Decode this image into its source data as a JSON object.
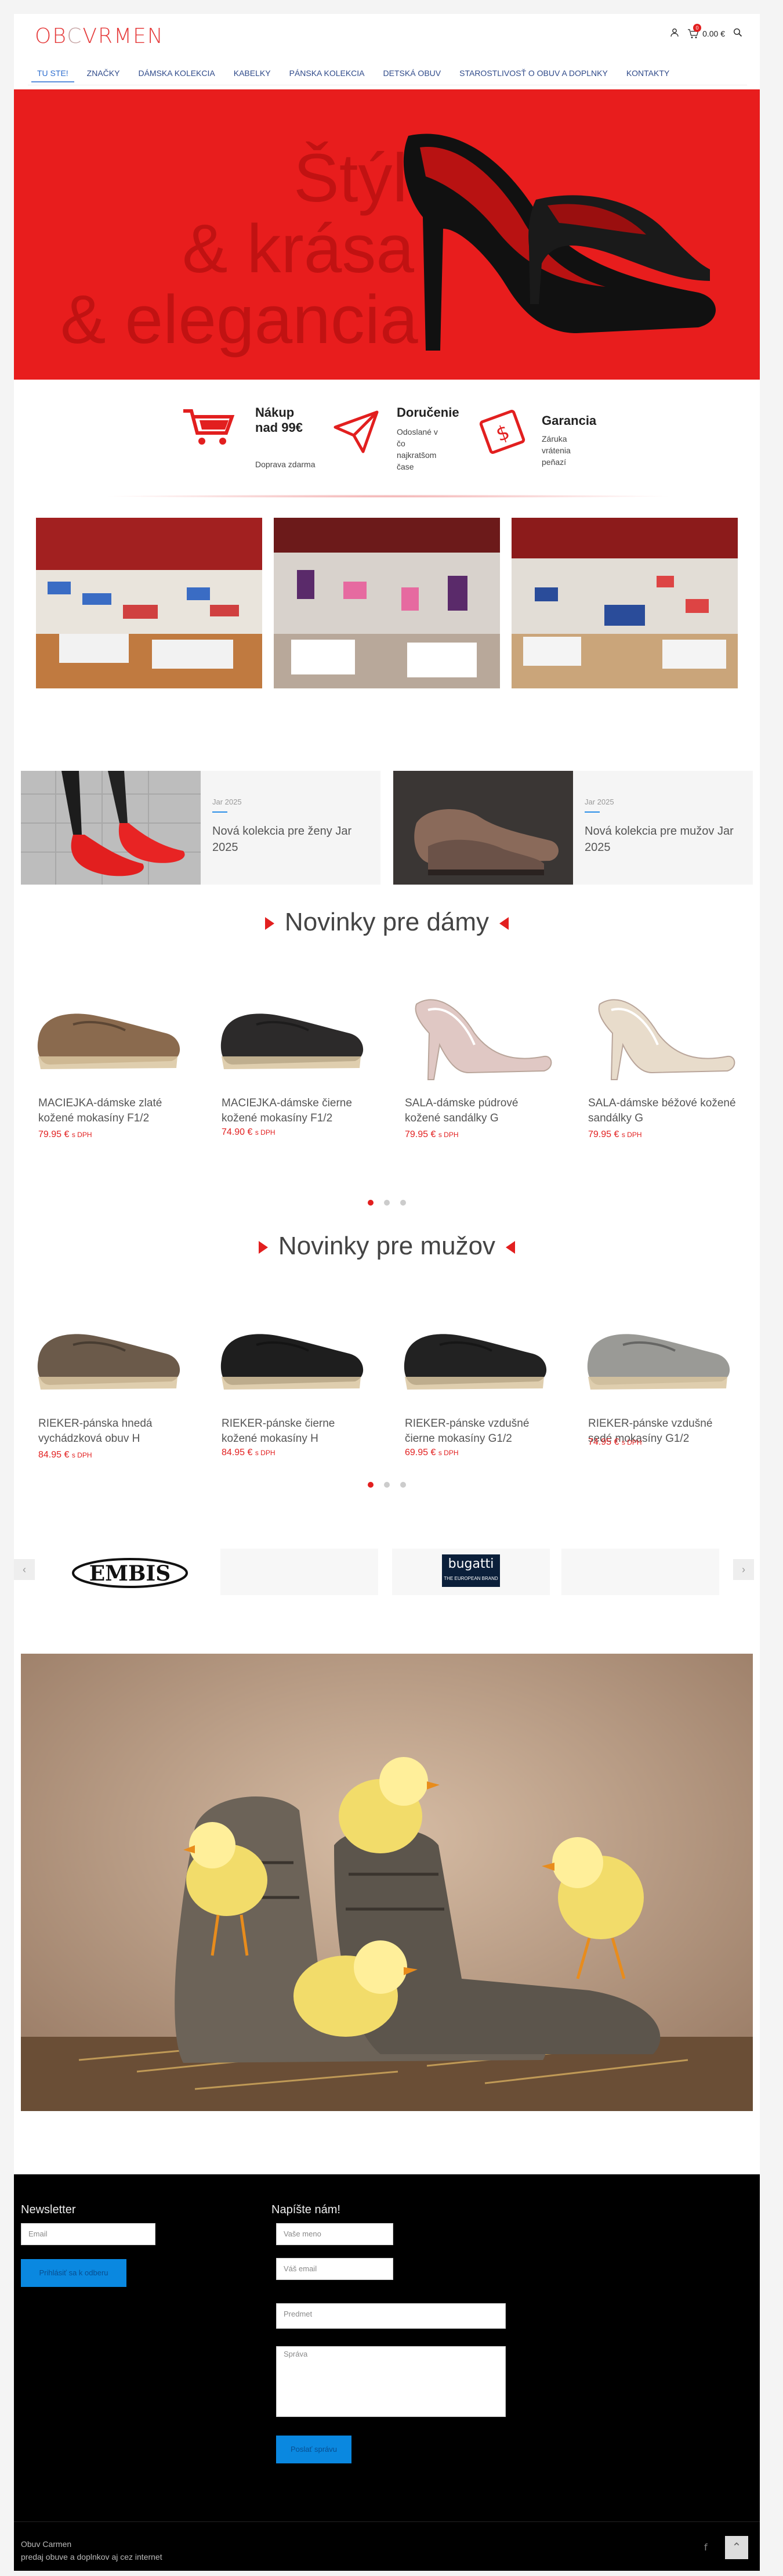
{
  "header": {
    "logo_text": "OBCVRMEN",
    "cart_count": "0",
    "cart_total": "0.00 €",
    "nav": [
      "Tu ste!",
      "Značky",
      "Dámska kolekcia",
      "Kabelky",
      "Pánska kolekcia",
      "Detská obuv",
      "Starostlivosť o obuv a doplnky",
      "Kontakty"
    ]
  },
  "hero": {
    "line1": "Štýl",
    "line2": "& krása",
    "line3": "& elegancia"
  },
  "features": [
    {
      "title": "Nákup nad 99€",
      "text": "Doprava zdarma",
      "icon": "cart-icon"
    },
    {
      "title": "Doručenie",
      "text": "Odoslané v čo najkratšom čase",
      "icon": "paper-plane-icon"
    },
    {
      "title": "Garancia",
      "text": "Záruka vrátenia peňazí",
      "icon": "money-back-icon"
    }
  ],
  "promos": [
    {
      "date": "Jar 2025",
      "title": "Nová kolekcia pre ženy Jar 2025"
    },
    {
      "date": "Jar 2025",
      "title": "Nová kolekcia pre mužov Jar 2025"
    }
  ],
  "women": {
    "heading": "Novinky pre dámy",
    "products": [
      {
        "name": "MACIEJKA-dámske zlaté kožené mokasíny F1/2",
        "price": "79.95 €",
        "tax": "s DPH",
        "color": "#8a6a4e"
      },
      {
        "name": "MACIEJKA-dámske čierne kožené mokasíny F1/2",
        "price": "74.90 €",
        "tax": "s DPH",
        "color": "#2c2a2a"
      },
      {
        "name": "SALA-dámske púdrové kožené sandálky G",
        "price": "79.95 €",
        "tax": "s DPH",
        "color": "#e0c8c4"
      },
      {
        "name": "SALA-dámske béžové kožené sandálky G",
        "price": "79.95 €",
        "tax": "s DPH",
        "color": "#e8dccb"
      }
    ]
  },
  "men": {
    "heading": "Novinky pre mužov",
    "products": [
      {
        "name": "RIEKER-pánska hnedá vychádzková obuv H",
        "price": "84.95 €",
        "tax": "s DPH",
        "color": "#6b5a4a"
      },
      {
        "name": "RIEKER-pánske čierne kožené mokasíny H",
        "price": "84.95 €",
        "tax": "s DPH",
        "color": "#1e1e1e"
      },
      {
        "name": "RIEKER-pánske vzdušné čierne mokasíny G1/2",
        "price": "69.95 €",
        "tax": "s DPH",
        "color": "#222"
      },
      {
        "name": "RIEKER-pánske vzdušné sedé mokasíny G1/2",
        "price": "74.95 €",
        "tax": "s DPH",
        "color": "#9a9a96"
      }
    ]
  },
  "brands": [
    "EMBIS",
    "",
    "bugatti",
    ""
  ],
  "brands_sub": {
    "bugatti": "THE EUROPEAN BRAND"
  },
  "footer": {
    "newsletter_title": "Newsletter",
    "email_placeholder": "Email",
    "subscribe_label": "Prihlásiť sa k odberu",
    "contact_title": "Napíšte nám!",
    "name_placeholder": "Vaše meno",
    "email2_placeholder": "Váš email",
    "subject_placeholder": "Predmet",
    "message_placeholder": "Správa",
    "send_label": "Poslať správu",
    "company": "Obuv Carmen",
    "tagline": "predaj obuve a doplnkov aj cez internet"
  }
}
